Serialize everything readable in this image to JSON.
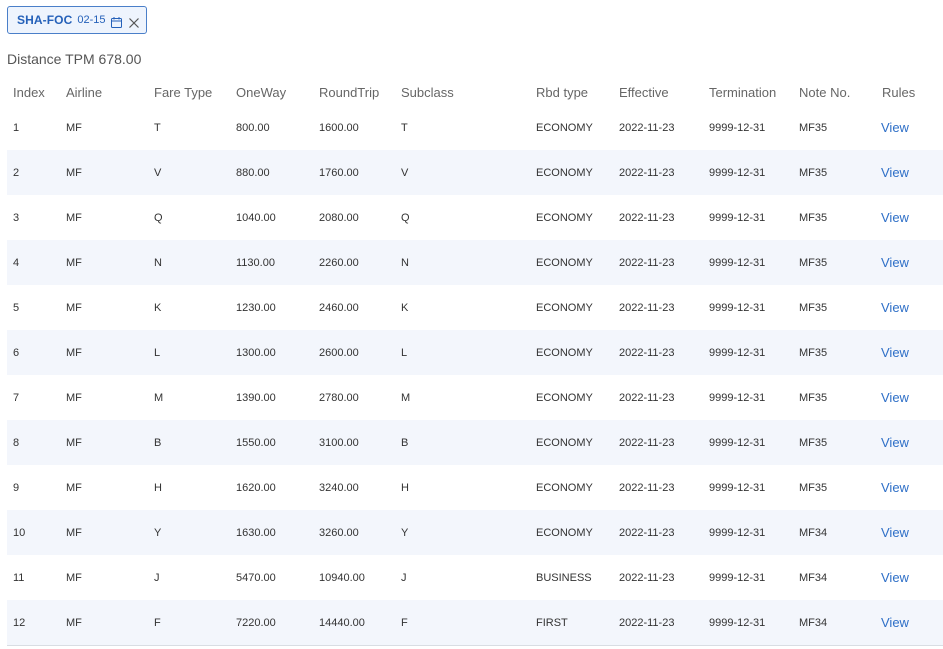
{
  "tag": {
    "route": "SHA-FOC",
    "date": "02-15",
    "calendar_icon": "calendar-icon",
    "close_icon": "close-icon"
  },
  "distance": {
    "label": "Distance TPM 678.00"
  },
  "table": {
    "headers": [
      "Index",
      "Airline",
      "Fare Type",
      "OneWay",
      "RoundTrip",
      "Subclass",
      "Rbd type",
      "Effective",
      "Termination",
      "Note No.",
      "Rules"
    ],
    "rows": [
      {
        "index": "1",
        "airline": "MF",
        "fare_type": "T",
        "oneway": "800.00",
        "roundtrip": "1600.00",
        "subclass": "T",
        "rbd_type": "ECONOMY",
        "effective": "2022-11-23",
        "termination": "9999-12-31",
        "note_no": "MF35",
        "rules": "View"
      },
      {
        "index": "2",
        "airline": "MF",
        "fare_type": "V",
        "oneway": "880.00",
        "roundtrip": "1760.00",
        "subclass": "V",
        "rbd_type": "ECONOMY",
        "effective": "2022-11-23",
        "termination": "9999-12-31",
        "note_no": "MF35",
        "rules": "View"
      },
      {
        "index": "3",
        "airline": "MF",
        "fare_type": "Q",
        "oneway": "1040.00",
        "roundtrip": "2080.00",
        "subclass": "Q",
        "rbd_type": "ECONOMY",
        "effective": "2022-11-23",
        "termination": "9999-12-31",
        "note_no": "MF35",
        "rules": "View"
      },
      {
        "index": "4",
        "airline": "MF",
        "fare_type": "N",
        "oneway": "1130.00",
        "roundtrip": "2260.00",
        "subclass": "N",
        "rbd_type": "ECONOMY",
        "effective": "2022-11-23",
        "termination": "9999-12-31",
        "note_no": "MF35",
        "rules": "View"
      },
      {
        "index": "5",
        "airline": "MF",
        "fare_type": "K",
        "oneway": "1230.00",
        "roundtrip": "2460.00",
        "subclass": "K",
        "rbd_type": "ECONOMY",
        "effective": "2022-11-23",
        "termination": "9999-12-31",
        "note_no": "MF35",
        "rules": "View"
      },
      {
        "index": "6",
        "airline": "MF",
        "fare_type": "L",
        "oneway": "1300.00",
        "roundtrip": "2600.00",
        "subclass": "L",
        "rbd_type": "ECONOMY",
        "effective": "2022-11-23",
        "termination": "9999-12-31",
        "note_no": "MF35",
        "rules": "View"
      },
      {
        "index": "7",
        "airline": "MF",
        "fare_type": "M",
        "oneway": "1390.00",
        "roundtrip": "2780.00",
        "subclass": "M",
        "rbd_type": "ECONOMY",
        "effective": "2022-11-23",
        "termination": "9999-12-31",
        "note_no": "MF35",
        "rules": "View"
      },
      {
        "index": "8",
        "airline": "MF",
        "fare_type": "B",
        "oneway": "1550.00",
        "roundtrip": "3100.00",
        "subclass": "B",
        "rbd_type": "ECONOMY",
        "effective": "2022-11-23",
        "termination": "9999-12-31",
        "note_no": "MF35",
        "rules": "View"
      },
      {
        "index": "9",
        "airline": "MF",
        "fare_type": "H",
        "oneway": "1620.00",
        "roundtrip": "3240.00",
        "subclass": "H",
        "rbd_type": "ECONOMY",
        "effective": "2022-11-23",
        "termination": "9999-12-31",
        "note_no": "MF35",
        "rules": "View"
      },
      {
        "index": "10",
        "airline": "MF",
        "fare_type": "Y",
        "oneway": "1630.00",
        "roundtrip": "3260.00",
        "subclass": "Y",
        "rbd_type": "ECONOMY",
        "effective": "2022-11-23",
        "termination": "9999-12-31",
        "note_no": "MF34",
        "rules": "View"
      },
      {
        "index": "11",
        "airline": "MF",
        "fare_type": "J",
        "oneway": "5470.00",
        "roundtrip": "10940.00",
        "subclass": "J",
        "rbd_type": "BUSINESS",
        "effective": "2022-11-23",
        "termination": "9999-12-31",
        "note_no": "MF34",
        "rules": "View"
      },
      {
        "index": "12",
        "airline": "MF",
        "fare_type": "F",
        "oneway": "7220.00",
        "roundtrip": "14440.00",
        "subclass": "F",
        "rbd_type": "FIRST",
        "effective": "2022-11-23",
        "termination": "9999-12-31",
        "note_no": "MF34",
        "rules": "View"
      }
    ]
  },
  "colors": {
    "accent": "#2e6fc7",
    "tag_border": "#4a7fc9",
    "tag_background": "#eef4fd",
    "row_stripe": "#f3f6fc"
  }
}
